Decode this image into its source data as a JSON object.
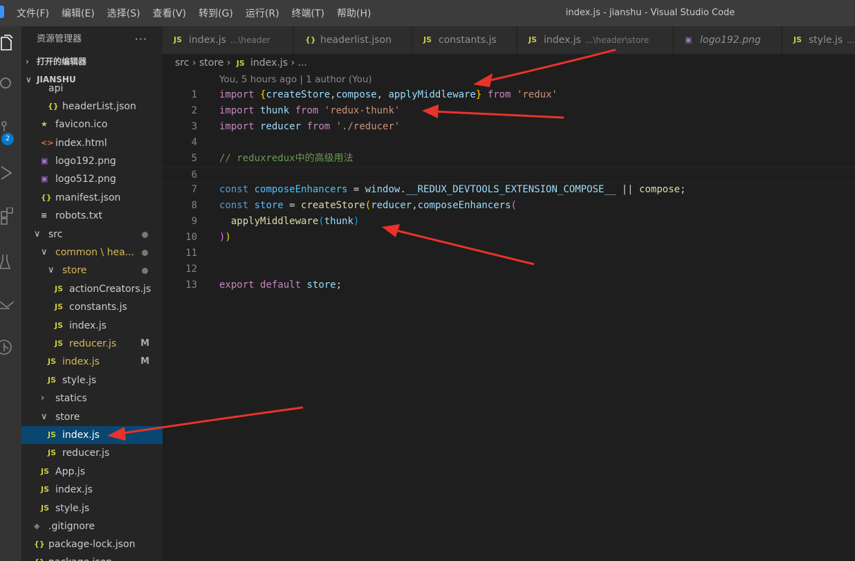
{
  "titlebar": {
    "menu": [
      "文件(F)",
      "编辑(E)",
      "选择(S)",
      "查看(V)",
      "转到(G)",
      "运行(R)",
      "终端(T)",
      "帮助(H)"
    ],
    "window_title": "index.js - jianshu - Visual Studio Code"
  },
  "activitybar": {
    "icons": [
      "explorer-icon",
      "search-icon",
      "source-control-icon",
      "run-debug-icon",
      "extensions-icon",
      "testing-icon",
      "remote-icon",
      "git-graph-icon"
    ],
    "scm_badge": "2"
  },
  "sidebar": {
    "title": "资源管理器",
    "more": "···",
    "open_editors": "打开的编辑器",
    "project": "JIANSHU",
    "items": [
      {
        "label": "api",
        "icon": "chevron",
        "glyph": "",
        "indent": 1
      },
      {
        "label": "headerList.json",
        "icon": "json",
        "glyph": "{}",
        "indent": 3
      },
      {
        "label": "favicon.ico",
        "icon": "star",
        "glyph": "★",
        "indent": 2
      },
      {
        "label": "index.html",
        "icon": "html",
        "glyph": "<>",
        "indent": 2
      },
      {
        "label": "logo192.png",
        "icon": "img",
        "glyph": "▣",
        "indent": 2
      },
      {
        "label": "logo512.png",
        "icon": "img",
        "glyph": "▣",
        "indent": 2
      },
      {
        "label": "manifest.json",
        "icon": "json",
        "glyph": "{}",
        "indent": 2
      },
      {
        "label": "robots.txt",
        "icon": "txt",
        "glyph": "≡",
        "indent": 2
      },
      {
        "label": "src",
        "icon": "chevron-down",
        "glyph": "∨",
        "indent": 1,
        "dot": true
      },
      {
        "label": "common \\ hea...",
        "icon": "chevron-down",
        "glyph": "∨",
        "indent": 2,
        "dot": true,
        "color": "yel"
      },
      {
        "label": "store",
        "icon": "chevron-down",
        "glyph": "∨",
        "indent": 3,
        "dot": true,
        "color": "yel"
      },
      {
        "label": "actionCreators.js",
        "icon": "js",
        "glyph": "JS",
        "indent": 4
      },
      {
        "label": "constants.js",
        "icon": "js",
        "glyph": "JS",
        "indent": 4
      },
      {
        "label": "index.js",
        "icon": "js",
        "glyph": "JS",
        "indent": 4
      },
      {
        "label": "reducer.js",
        "icon": "js",
        "glyph": "JS",
        "indent": 4,
        "m": "M",
        "color": "yel"
      },
      {
        "label": "index.js",
        "icon": "js",
        "glyph": "JS",
        "indent": 3,
        "m": "M",
        "color": "yel"
      },
      {
        "label": "style.js",
        "icon": "js",
        "glyph": "JS",
        "indent": 3
      },
      {
        "label": "statics",
        "icon": "chevron-right",
        "glyph": "›",
        "indent": 2
      },
      {
        "label": "store",
        "icon": "chevron-down",
        "glyph": "∨",
        "indent": 2
      },
      {
        "label": "index.js",
        "icon": "js",
        "glyph": "JS",
        "indent": 3,
        "selected": true
      },
      {
        "label": "reducer.js",
        "icon": "js",
        "glyph": "JS",
        "indent": 3
      },
      {
        "label": "App.js",
        "icon": "js",
        "glyph": "JS",
        "indent": 2
      },
      {
        "label": "index.js",
        "icon": "js",
        "glyph": "JS",
        "indent": 2
      },
      {
        "label": "style.js",
        "icon": "js",
        "glyph": "JS",
        "indent": 2
      },
      {
        "label": ".gitignore",
        "icon": "git",
        "glyph": "◆",
        "indent": 1
      },
      {
        "label": "package-lock.json",
        "icon": "json",
        "glyph": "{}",
        "indent": 1
      },
      {
        "label": "package.json",
        "icon": "json",
        "glyph": "{}",
        "indent": 1
      }
    ]
  },
  "tabs": [
    {
      "glyph": "JS",
      "name": "index.js",
      "desc": "...\\header"
    },
    {
      "glyph": "{}",
      "name": "headerlist.json",
      "desc": ""
    },
    {
      "glyph": "JS",
      "name": "constants.js",
      "desc": ""
    },
    {
      "glyph": "JS",
      "name": "index.js",
      "desc": "...\\header\\store"
    },
    {
      "glyph": "▣",
      "name": "logo192.png",
      "desc": ""
    },
    {
      "glyph": "JS",
      "name": "style.js",
      "desc": "...\\"
    }
  ],
  "breadcrumb": {
    "parts": [
      "src",
      "store",
      "index.js",
      "..."
    ],
    "sep": "›"
  },
  "editor": {
    "blame": "You, 5 hours ago | 1 author (You)",
    "lines": [
      {
        "n": "1",
        "tokens": [
          [
            "kw",
            "import"
          ],
          [
            "pn",
            " "
          ],
          [
            "b1",
            "{"
          ],
          [
            "var",
            "createStore"
          ],
          [
            "pn",
            ","
          ],
          [
            "var",
            "compose"
          ],
          [
            "pn",
            ", "
          ],
          [
            "var",
            "applyMiddleware"
          ],
          [
            "b1",
            "}"
          ],
          [
            "pn",
            " "
          ],
          [
            "kw",
            "from"
          ],
          [
            "pn",
            " "
          ],
          [
            "str",
            "'redux'"
          ]
        ]
      },
      {
        "n": "2",
        "tokens": [
          [
            "kw",
            "import"
          ],
          [
            "pn",
            " "
          ],
          [
            "var",
            "thunk"
          ],
          [
            "pn",
            " "
          ],
          [
            "kw",
            "from"
          ],
          [
            "pn",
            " "
          ],
          [
            "str",
            "'redux-thunk'"
          ]
        ]
      },
      {
        "n": "3",
        "tokens": [
          [
            "kw",
            "import"
          ],
          [
            "pn",
            " "
          ],
          [
            "var",
            "reducer"
          ],
          [
            "pn",
            " "
          ],
          [
            "kw",
            "from"
          ],
          [
            "pn",
            " "
          ],
          [
            "str",
            "'./reducer'"
          ]
        ]
      },
      {
        "n": "4",
        "tokens": []
      },
      {
        "n": "5",
        "tokens": [
          [
            "cm",
            "// reduxredux中的高级用法"
          ]
        ]
      },
      {
        "n": "6",
        "tokens": [],
        "current": true
      },
      {
        "n": "7",
        "tokens": [
          [
            "kw2",
            "const"
          ],
          [
            "pn",
            " "
          ],
          [
            "cn",
            "composeEnhancers"
          ],
          [
            "pn",
            " = "
          ],
          [
            "var",
            "window"
          ],
          [
            "pn",
            "."
          ],
          [
            "var",
            "__REDUX_DEVTOOLS_EXTENSION_COMPOSE__"
          ],
          [
            "pn",
            " || "
          ],
          [
            "fn",
            "compose"
          ],
          [
            "pn",
            ";"
          ]
        ]
      },
      {
        "n": "8",
        "tokens": [
          [
            "kw2",
            "const"
          ],
          [
            "pn",
            " "
          ],
          [
            "cn",
            "store"
          ],
          [
            "pn",
            " = "
          ],
          [
            "fn",
            "createStore"
          ],
          [
            "b1",
            "("
          ],
          [
            "var",
            "reducer"
          ],
          [
            "pn",
            ","
          ],
          [
            "var",
            "composeEnhancers"
          ],
          [
            "b2",
            "("
          ]
        ]
      },
      {
        "n": "9",
        "tokens": [
          [
            "pn",
            "  "
          ],
          [
            "fn",
            "applyMiddleware"
          ],
          [
            "b3",
            "("
          ],
          [
            "var",
            "thunk"
          ],
          [
            "b3",
            ")"
          ]
        ]
      },
      {
        "n": "10",
        "tokens": [
          [
            "b2",
            ")"
          ],
          [
            "b1",
            ")"
          ]
        ]
      },
      {
        "n": "11",
        "tokens": []
      },
      {
        "n": "12",
        "tokens": []
      },
      {
        "n": "13",
        "tokens": [
          [
            "kw",
            "export"
          ],
          [
            "pn",
            " "
          ],
          [
            "kw",
            "default"
          ],
          [
            "pn",
            " "
          ],
          [
            "var",
            "store"
          ],
          [
            "pn",
            ";"
          ]
        ]
      }
    ]
  },
  "colors": {
    "arrow": "#e8332a",
    "selection": "#094771",
    "accent": "#007acc"
  }
}
